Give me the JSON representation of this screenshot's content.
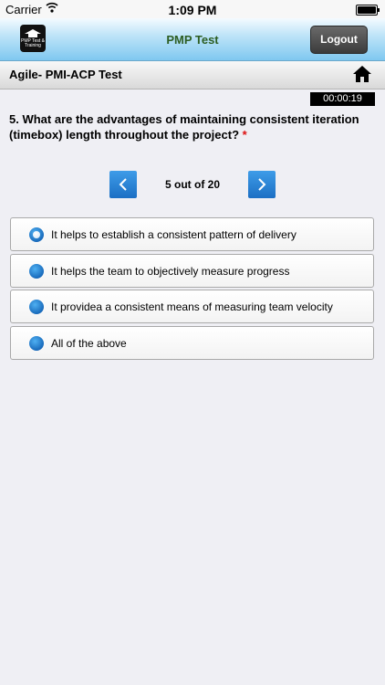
{
  "status_bar": {
    "carrier": "Carrier",
    "time": "1:09 PM"
  },
  "header": {
    "title": "PMP Test",
    "logout_label": "Logout",
    "logo_text": "PMP Test & Training",
    "logo_icon": "graduation-cap-icon"
  },
  "sub_header": {
    "title": "Agile- PMI-ACP Test",
    "home_icon": "home-icon"
  },
  "timer": "00:00:19",
  "question": {
    "text": "5. What are the advantages of maintaining consistent iteration (timebox) length throughout the  project?",
    "required_marker": "*"
  },
  "pagination": {
    "label": "5 out of 20",
    "current": 5,
    "total": 20
  },
  "options": [
    {
      "label": "It helps to establish a consistent pattern of delivery",
      "selected": true
    },
    {
      "label": "It helps the team to objectively measure progress",
      "selected": false
    },
    {
      "label": "It providea a consistent means of measuring team velocity",
      "selected": false
    },
    {
      "label": "All of the above",
      "selected": false
    }
  ],
  "colors": {
    "header_title": "#2d5e23",
    "accent_blue": "#1c6fc4",
    "required": "#dd1111"
  }
}
